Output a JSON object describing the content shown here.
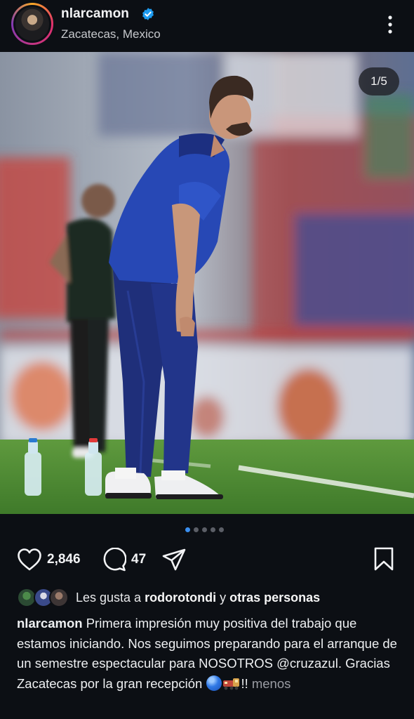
{
  "header": {
    "username": "nlarcamon",
    "location": "Zacatecas, Mexico",
    "icons": {
      "verified": "verified-badge-icon",
      "more": "more-vertical-icon"
    }
  },
  "post": {
    "counter": "1/5",
    "carousel": {
      "total": 5,
      "active_index": 0
    }
  },
  "actions": {
    "likes_count": "2,846",
    "comments_count": "47",
    "icons": [
      "heart-icon",
      "comment-icon",
      "share-icon",
      "bookmark-icon"
    ]
  },
  "likes": {
    "prefix": "Les gusta a",
    "user": "rodorotondi",
    "connector": "y",
    "others": "otras personas"
  },
  "caption": {
    "username": "nlarcamon",
    "text_part1": "Primera impresión muy positiva del trabajo que estamos iniciando. Nos seguimos preparando para el arranque de un semestre espectacular para NOSOTROS",
    "mention": "@cruzazul",
    "text_part2": ". Gracias Zacatecas por la gran recepción",
    "text_part3": "!!",
    "less_label": "menos"
  },
  "colors": {
    "background": "#0c0f14",
    "accent_blue": "#3a8ff0",
    "verified_blue": "#1d9bf0",
    "muted_text": "#9a9ca3"
  }
}
